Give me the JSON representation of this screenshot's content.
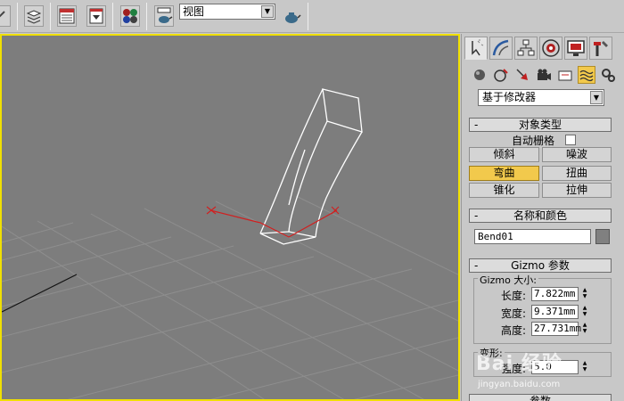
{
  "toolbar": {
    "view_dropdown": "视图"
  },
  "panel": {
    "modifier_list": "基于修改器",
    "object_type": {
      "title": "对象类型",
      "autogrid_label": "自动栅格",
      "buttons": [
        "倾斜",
        "噪波",
        "弯曲",
        "扭曲",
        "锥化",
        "拉伸"
      ],
      "active": "弯曲"
    },
    "name_color": {
      "title": "名称和颜色",
      "name_value": "Bend01",
      "color": "#808080"
    },
    "gizmo": {
      "title": "Gizmo 参数",
      "size_group": "Gizmo 大小:",
      "length_label": "长度:",
      "length_value": "7.822mm",
      "width_label": "宽度:",
      "width_value": "9.371mm",
      "height_label": "高度:",
      "height_value": "27.731mm",
      "deform_group": "变形:",
      "strength_label": "强度:",
      "strength_value": "5.0"
    },
    "params_title": "参数"
  },
  "watermark": {
    "brand": "Bai 经验",
    "url": "jingyan.baidu.com"
  },
  "colors": {
    "viewport_bg": "#7d7d7d",
    "viewport_border": "#f0e000",
    "active_button": "#f2c94c",
    "gizmo_line": "#d02020"
  }
}
